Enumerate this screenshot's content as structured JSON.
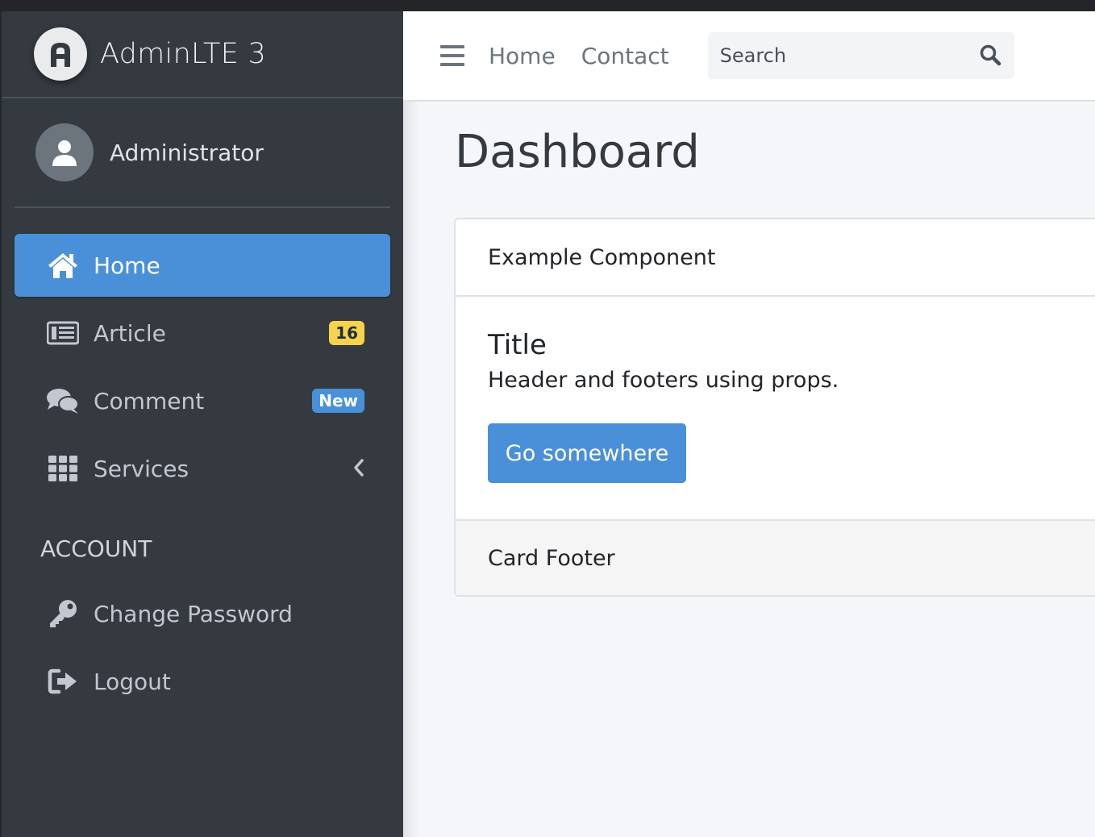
{
  "brand": {
    "name": "AdminLTE 3",
    "logo_icon": "adminlte-logo"
  },
  "user": {
    "name": "Administrator",
    "avatar_icon": "user-icon"
  },
  "sidebar": {
    "items": [
      {
        "label": "Home",
        "icon": "home-icon",
        "active": true
      },
      {
        "label": "Article",
        "icon": "newspaper-icon",
        "badge": "16",
        "badge_color": "#f6d34a"
      },
      {
        "label": "Comment",
        "icon": "comments-icon",
        "badge": "New",
        "badge_color": "#4a90d9"
      },
      {
        "label": "Services",
        "icon": "grid-icon",
        "has_submenu": true
      }
    ],
    "account_header": "ACCOUNT",
    "account_items": [
      {
        "label": "Change Password",
        "icon": "key-icon"
      },
      {
        "label": "Logout",
        "icon": "logout-icon"
      }
    ]
  },
  "navbar": {
    "links": [
      "Home",
      "Contact"
    ],
    "search_placeholder": "Search"
  },
  "page": {
    "title": "Dashboard"
  },
  "card": {
    "header": "Example Component",
    "title": "Title",
    "text": "Header and footers using props.",
    "button_label": "Go somewhere",
    "footer": "Card Footer"
  },
  "colors": {
    "sidebar_bg": "#343a40",
    "accent": "#4a90d9",
    "content_bg": "#f4f6f9"
  }
}
